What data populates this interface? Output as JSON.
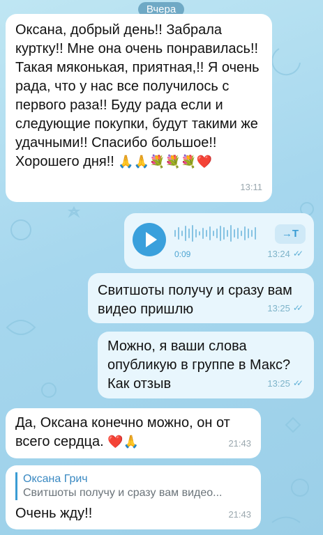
{
  "chat": {
    "date_chip": "Вчера",
    "messages": [
      {
        "text": "Оксана, добрый день!! Забрала куртку!! Мне она очень понравилась!! Такая мяконькая, приятная,!! Я очень рада, что  у нас все получилось с первого раза!! Буду рада если и следующие покупки, будут такими же удачными!! Спасибо большое!! Хорошего дня!!",
        "emoji": "🙏🙏💐💐💐",
        "heart": "❤️",
        "time": "13:11"
      },
      {
        "voice_duration": "0:09",
        "transcribe_label": "→T",
        "time": "13:24"
      },
      {
        "text": "Свитшоты получу и сразу вам видео пришлю",
        "time": "13:25"
      },
      {
        "text": "Можно, я ваши слова опубликую в группе в Макс? Как отзыв",
        "time": "13:25"
      },
      {
        "text": "Да, Оксана конечно можно, он от всего сердца.",
        "heart": "❤️",
        "emoji": "🙏",
        "time": "21:43"
      },
      {
        "reply_author": "Оксана Грич",
        "reply_text": "Свитшоты получу и сразу вам видео...",
        "text": "Очень жду!!",
        "time": "21:43"
      }
    ]
  },
  "colors": {
    "incoming_bubble": "#ffffff",
    "outgoing_bubble": "#e8f6fd",
    "accent": "#3aa0dc",
    "background": "#a6d7ee"
  }
}
